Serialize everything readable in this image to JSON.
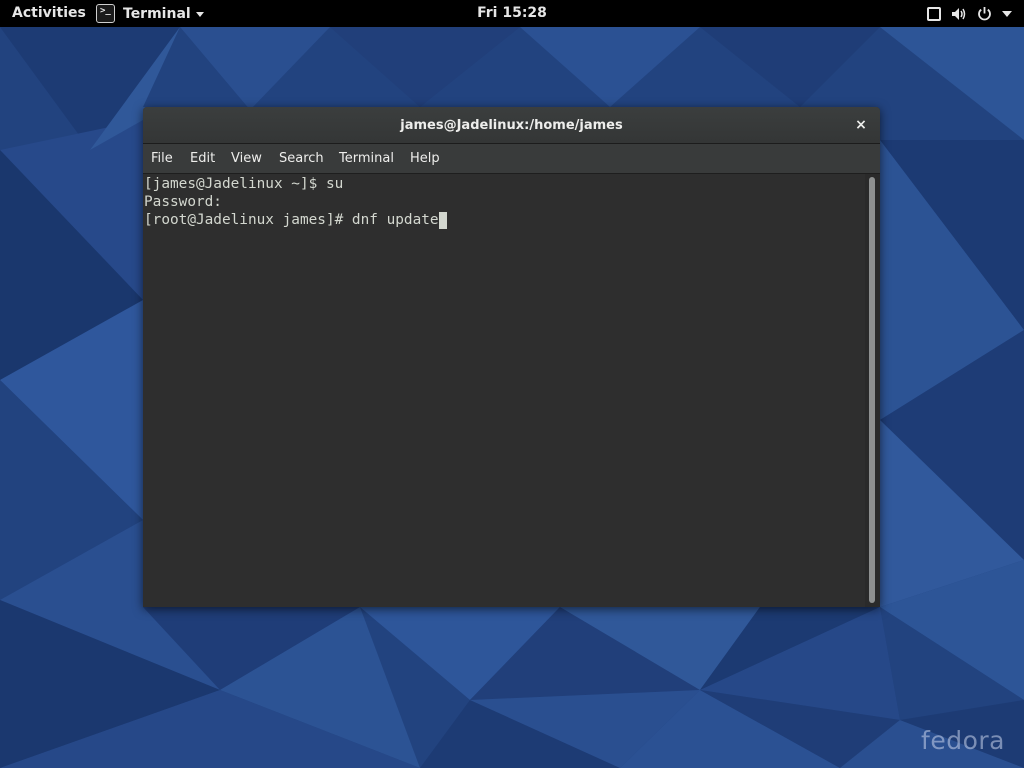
{
  "desktop": {
    "wallpaper_colors": [
      "#1c3a73",
      "#22437f",
      "#274b8a",
      "#2c5394",
      "#31599c",
      "#193568",
      "#2f57a0"
    ],
    "watermark": "fedora"
  },
  "topbar": {
    "activities": "Activities",
    "app_menu_label": "Terminal",
    "app_icon_glyph": ">_",
    "clock": "Fri 15:28",
    "status_icons": [
      "window-icon",
      "volume-icon",
      "power-icon",
      "chevron-down-icon"
    ]
  },
  "window": {
    "title": "james@Jadelinux:/home/james",
    "close_glyph": "×",
    "menu": {
      "file": "File",
      "edit": "Edit",
      "view": "View",
      "search": "Search",
      "terminal": "Terminal",
      "help": "Help"
    },
    "terminal": {
      "line1": "[james@Jadelinux ~]$ su",
      "line2": "Password:",
      "line3": "[root@Jadelinux james]# dnf update"
    }
  },
  "colors": {
    "terminal_bg": "#2e2e2e",
    "terminal_fg": "#d3d7cf",
    "titlebar_bg": "#393b3b",
    "topbar_bg": "#000000"
  }
}
